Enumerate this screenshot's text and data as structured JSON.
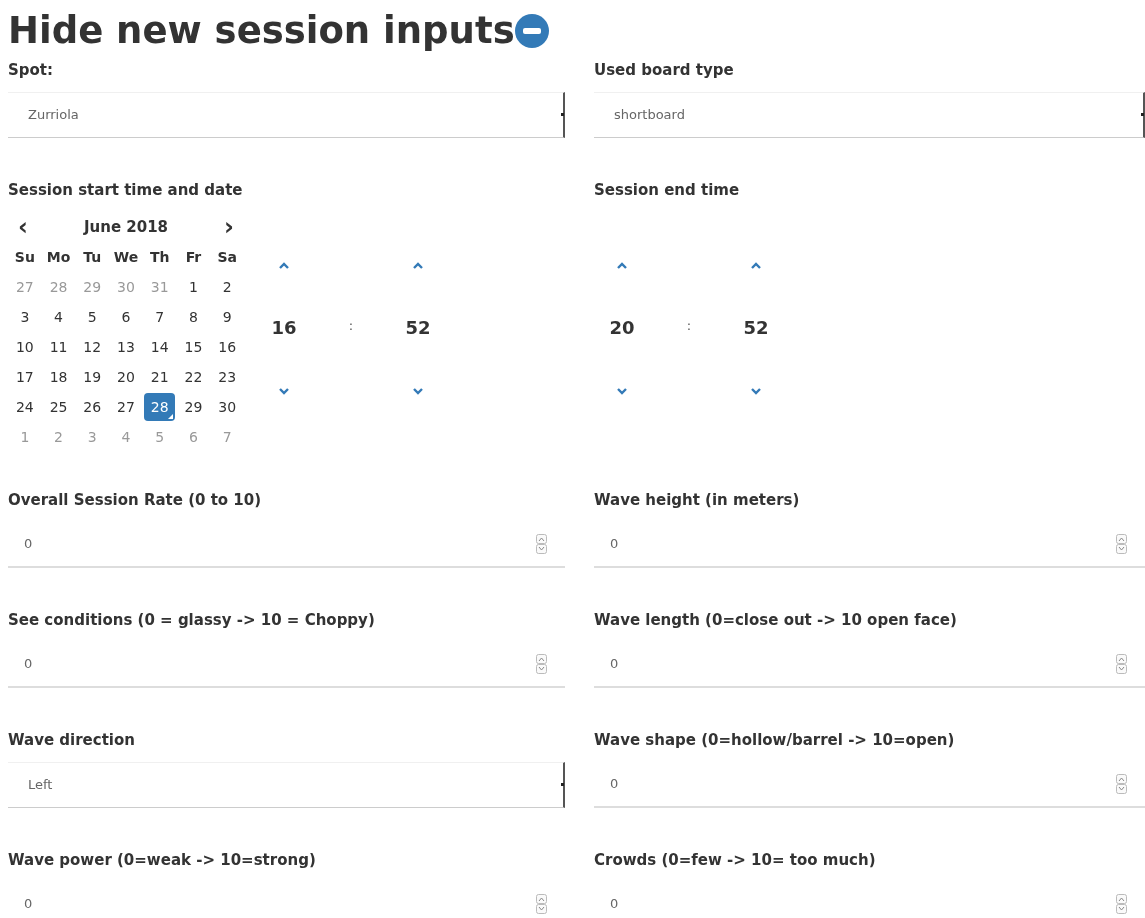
{
  "heading": {
    "text": "Hide new session inputs",
    "expanded": true
  },
  "fields": [
    {
      "kind": "select",
      "label": "Spot:",
      "value": "Zurriola"
    },
    {
      "kind": "select",
      "label": "Used board type",
      "value": "shortboard"
    },
    {
      "kind": "datetime",
      "label": "Session start time and date",
      "calendar": {
        "prev": "‹",
        "next": "›",
        "month": "June 2018",
        "weekdays": [
          "Su",
          "Mo",
          "Tu",
          "We",
          "Th",
          "Fr",
          "Sa"
        ],
        "days": [
          {
            "text": "27",
            "muted": true,
            "selected": false
          },
          {
            "text": "28",
            "muted": true,
            "selected": false
          },
          {
            "text": "29",
            "muted": true,
            "selected": false
          },
          {
            "text": "30",
            "muted": true,
            "selected": false
          },
          {
            "text": "31",
            "muted": true,
            "selected": false
          },
          {
            "text": "1",
            "muted": false,
            "selected": false
          },
          {
            "text": "2",
            "muted": false,
            "selected": false
          },
          {
            "text": "3",
            "muted": false,
            "selected": false
          },
          {
            "text": "4",
            "muted": false,
            "selected": false
          },
          {
            "text": "5",
            "muted": false,
            "selected": false
          },
          {
            "text": "6",
            "muted": false,
            "selected": false
          },
          {
            "text": "7",
            "muted": false,
            "selected": false
          },
          {
            "text": "8",
            "muted": false,
            "selected": false
          },
          {
            "text": "9",
            "muted": false,
            "selected": false
          },
          {
            "text": "10",
            "muted": false,
            "selected": false
          },
          {
            "text": "11",
            "muted": false,
            "selected": false
          },
          {
            "text": "12",
            "muted": false,
            "selected": false
          },
          {
            "text": "13",
            "muted": false,
            "selected": false
          },
          {
            "text": "14",
            "muted": false,
            "selected": false
          },
          {
            "text": "15",
            "muted": false,
            "selected": false
          },
          {
            "text": "16",
            "muted": false,
            "selected": false
          },
          {
            "text": "17",
            "muted": false,
            "selected": false
          },
          {
            "text": "18",
            "muted": false,
            "selected": false
          },
          {
            "text": "19",
            "muted": false,
            "selected": false
          },
          {
            "text": "20",
            "muted": false,
            "selected": false
          },
          {
            "text": "21",
            "muted": false,
            "selected": false
          },
          {
            "text": "22",
            "muted": false,
            "selected": false
          },
          {
            "text": "23",
            "muted": false,
            "selected": false
          },
          {
            "text": "24",
            "muted": false,
            "selected": false
          },
          {
            "text": "25",
            "muted": false,
            "selected": false
          },
          {
            "text": "26",
            "muted": false,
            "selected": false
          },
          {
            "text": "27",
            "muted": false,
            "selected": false
          },
          {
            "text": "28",
            "muted": false,
            "selected": true
          },
          {
            "text": "29",
            "muted": false,
            "selected": false
          },
          {
            "text": "30",
            "muted": false,
            "selected": false
          },
          {
            "text": "1",
            "muted": true,
            "selected": false
          },
          {
            "text": "2",
            "muted": true,
            "selected": false
          },
          {
            "text": "3",
            "muted": true,
            "selected": false
          },
          {
            "text": "4",
            "muted": true,
            "selected": false
          },
          {
            "text": "5",
            "muted": true,
            "selected": false
          },
          {
            "text": "6",
            "muted": true,
            "selected": false
          },
          {
            "text": "7",
            "muted": true,
            "selected": false
          }
        ]
      },
      "time": {
        "hour": "16",
        "separator": ":",
        "minute": "52"
      }
    },
    {
      "kind": "time",
      "label": "Session end time",
      "time": {
        "hour": "20",
        "separator": ":",
        "minute": "52"
      }
    },
    {
      "kind": "number",
      "label": "Overall Session Rate (0 to 10)",
      "value": "0"
    },
    {
      "kind": "number",
      "label": "Wave height (in meters)",
      "value": "0"
    },
    {
      "kind": "number",
      "label": "See conditions (0 = glassy -> 10 = Choppy)",
      "value": "0"
    },
    {
      "kind": "number",
      "label": "Wave length (0=close out -> 10 open face)",
      "value": "0"
    },
    {
      "kind": "select",
      "label": "Wave direction",
      "value": "Left"
    },
    {
      "kind": "number",
      "label": "Wave shape (0=hollow/barrel -> 10=open)",
      "value": "0"
    },
    {
      "kind": "number",
      "label": "Wave power (0=weak -> 10=strong)",
      "value": "0"
    },
    {
      "kind": "number",
      "label": "Crowds (0=few -> 10= too much)",
      "value": "0"
    }
  ]
}
